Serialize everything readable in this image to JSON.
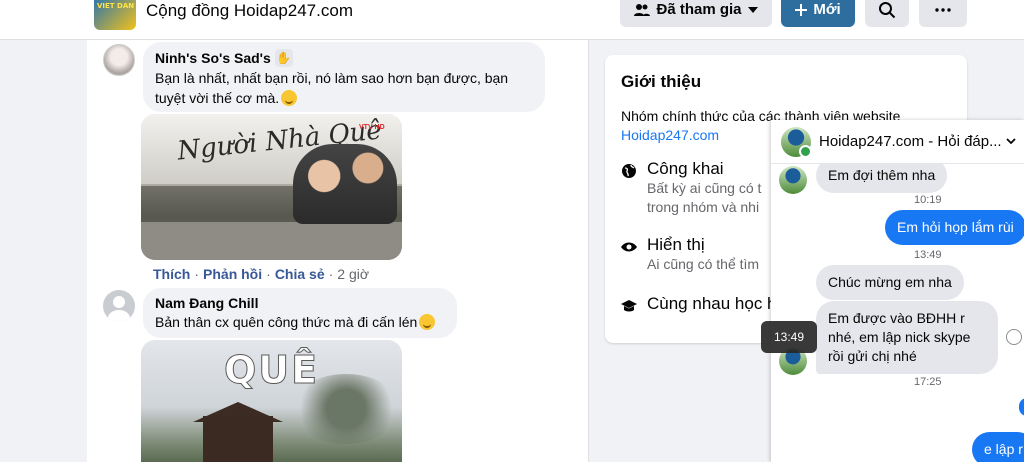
{
  "header": {
    "logo_text": "VIET DAN",
    "group_name": "Cộng đồng Hoidap247.com",
    "joined_label": "Đã tham gia",
    "new_label": "Mới",
    "icons": {
      "joined": "people-icon",
      "joined_caret": "caret-down-icon",
      "new": "plus-icon",
      "search": "search-icon",
      "more": "more-icon"
    }
  },
  "feed": {
    "comment1": {
      "author": "Ninh's So's Sad's",
      "text": "Bạn là nhất, nhất bạn rồi, nó làm sao hơn bạn được, bạn tuyệt vời thế cơ mà.",
      "image_title": "Người Nhà Quê",
      "image_logo": "VTV HD"
    },
    "actions": {
      "like": "Thích",
      "reply": "Phản hồi",
      "share": "Chia sẻ",
      "time": "2 giờ",
      "sep": "·"
    },
    "comment2": {
      "author": "Nam Đang Chill",
      "text": "Bản thân cx quên công thức mà đi cấn lén",
      "image_title": "QUÊ"
    }
  },
  "about": {
    "title": "Giới thiệu",
    "desc": "Nhóm chính thức của các thành viên website",
    "link": "Hoidap247.com",
    "rows": [
      {
        "icon": "globe-icon",
        "title": "Công khai",
        "sub1": "Bất kỳ ai cũng có t",
        "sub2": "trong nhóm và nhi"
      },
      {
        "icon": "eye-icon",
        "title": "Hiển thị",
        "sub1": "Ai cũng có thể tìm",
        "sub2": ""
      },
      {
        "icon": "graduation-cap-icon",
        "title": "Cùng nhau học h",
        "sub1": "",
        "sub2": ""
      }
    ]
  },
  "chat": {
    "name": "Hoidap247.com - Hỏi đáp...",
    "messages": {
      "m1": "Em đợi thêm nha",
      "t1": "10:19",
      "m2": "Em hỏi họp lắm rùi",
      "t2": "13:49",
      "m3": "Chúc mừng em nha",
      "m4": "Em được vào BĐHH r nhé, em lập nick skype rồi gửi chị nhé",
      "t3": "17:25",
      "m5": "e lập r",
      "tooltip": "13:49"
    }
  }
}
